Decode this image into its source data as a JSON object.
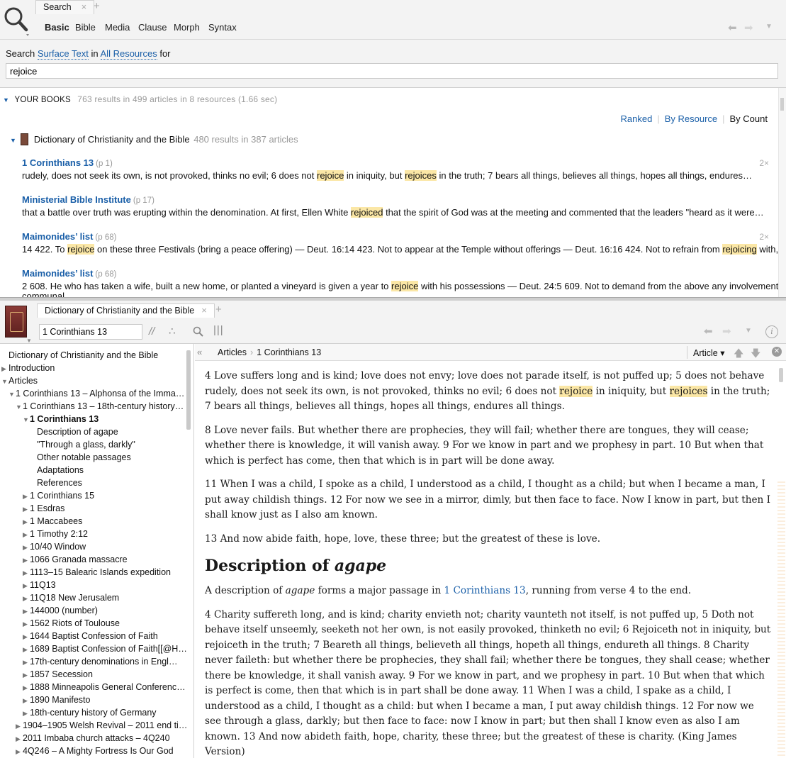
{
  "search_panel": {
    "tab_label": "Search",
    "tab_close": "×",
    "tab_add": "+",
    "subtabs": [
      "Basic",
      "Bible",
      "Media",
      "Clause",
      "Morph",
      "Syntax"
    ],
    "active_subtab": "Basic",
    "search_prefix": "Search",
    "search_field": "Surface Text",
    "search_in": "in",
    "search_scope": "All Resources",
    "search_for": "for",
    "query": "rejoice"
  },
  "results": {
    "section_title": "YOUR BOOKS",
    "summary": "763 results in 499 articles in 8 resources (1.66 sec)",
    "ranking": [
      "Ranked",
      "By Resource",
      "By Count"
    ],
    "active_ranking": "By Count",
    "book": {
      "title": "Dictionary of Christianity and the Bible",
      "count": "480 results in 387 articles"
    },
    "items": [
      {
        "title": "1 Corinthians 13",
        "page": "(p 1)",
        "count": "2×",
        "snippet": [
          {
            "t": "rudely, does not seek its own, is not provoked, thinks no evil; 6 does not "
          },
          {
            "t": "rejoice",
            "h": true
          },
          {
            "t": " in iniquity, but "
          },
          {
            "t": "rejoices",
            "h": true
          },
          {
            "t": " in the truth; 7 bears all things, believes all things, hopes all things, endures…"
          }
        ]
      },
      {
        "title": "Ministerial Bible Institute",
        "page": "(p 17)",
        "count": "",
        "snippet": [
          {
            "t": "that a battle over truth was erupting within the denomination. At first, Ellen White "
          },
          {
            "t": "rejoiced",
            "h": true
          },
          {
            "t": " that the spirit of God was at the meeting and commented that the leaders \"heard as it were…"
          }
        ]
      },
      {
        "title": "Maimonides’ list",
        "page": "(p 68)",
        "count": "2×",
        "snippet": [
          {
            "t": "14 422. To "
          },
          {
            "t": "rejoice",
            "h": true
          },
          {
            "t": " on these three Festivals (bring a peace offering) — Deut. 16:14 423. Not to appear at the Temple without offerings — Deut. 16:16 424. Not to refrain from "
          },
          {
            "t": "rejoicing",
            "h": true
          },
          {
            "t": " with, and…"
          }
        ]
      },
      {
        "title": "Maimonides’ list",
        "page": "(p 68)",
        "count": "",
        "snippet": [
          {
            "t": "2 608. He who has taken a wife, built a new home, or planted a vineyard is given a year to "
          },
          {
            "t": "rejoice",
            "h": true
          },
          {
            "t": " with his possessions — Deut. 24:5 609. Not to demand from the above any involvement,"
          }
        ],
        "snippet2": "communal"
      }
    ]
  },
  "resource_panel": {
    "tab_label": "Dictionary of Christianity and the Bible",
    "tab_close": "×",
    "tab_add": "+",
    "reference": "1 Corinthians 13",
    "breadcrumb": [
      "Articles",
      "1 Corinthians 13"
    ],
    "article_menu": "Article ▾",
    "toc": [
      {
        "label": "Dictionary of Christianity and the Bible",
        "level": 0,
        "arrow": "",
        "bold": false
      },
      {
        "label": "Introduction",
        "level": 0,
        "arrow": "▶",
        "bold": false
      },
      {
        "label": "Articles",
        "level": 0,
        "arrow": "▼",
        "bold": false
      },
      {
        "label": "1 Corinthians 13 – Alphonsa of the Imma…",
        "level": 1,
        "arrow": "▼",
        "bold": false
      },
      {
        "label": "1 Corinthians 13 – 18th-century history…",
        "level": 2,
        "arrow": "▼",
        "bold": false
      },
      {
        "label": "1 Corinthians 13",
        "level": 3,
        "arrow": "▼",
        "bold": true
      },
      {
        "label": "Description of agape",
        "level": 4,
        "arrow": "",
        "bold": false
      },
      {
        "label": "\"Through a glass, darkly\"",
        "level": 4,
        "arrow": "",
        "bold": false
      },
      {
        "label": "Other notable passages",
        "level": 4,
        "arrow": "",
        "bold": false
      },
      {
        "label": "Adaptations",
        "level": 4,
        "arrow": "",
        "bold": false
      },
      {
        "label": "References",
        "level": 4,
        "arrow": "",
        "bold": false
      },
      {
        "label": "1 Corinthians 15",
        "level": 3,
        "arrow": "▶",
        "bold": false
      },
      {
        "label": "1 Esdras",
        "level": 3,
        "arrow": "▶",
        "bold": false
      },
      {
        "label": "1 Maccabees",
        "level": 3,
        "arrow": "▶",
        "bold": false
      },
      {
        "label": "1 Timothy 2:12",
        "level": 3,
        "arrow": "▶",
        "bold": false
      },
      {
        "label": "10/40 Window",
        "level": 3,
        "arrow": "▶",
        "bold": false
      },
      {
        "label": "1066 Granada massacre",
        "level": 3,
        "arrow": "▶",
        "bold": false
      },
      {
        "label": "1113–15 Balearic Islands expedition",
        "level": 3,
        "arrow": "▶",
        "bold": false
      },
      {
        "label": "11Q13",
        "level": 3,
        "arrow": "▶",
        "bold": false
      },
      {
        "label": "11Q18 New Jerusalem",
        "level": 3,
        "arrow": "▶",
        "bold": false
      },
      {
        "label": "144000 (number)",
        "level": 3,
        "arrow": "▶",
        "bold": false
      },
      {
        "label": "1562 Riots of Toulouse",
        "level": 3,
        "arrow": "▶",
        "bold": false
      },
      {
        "label": "1644 Baptist Confession of Faith",
        "level": 3,
        "arrow": "▶",
        "bold": false
      },
      {
        "label": "1689 Baptist Confession of Faith[[@H…",
        "level": 3,
        "arrow": "▶",
        "bold": false
      },
      {
        "label": "17th-century denominations in Engl…",
        "level": 3,
        "arrow": "▶",
        "bold": false
      },
      {
        "label": "1857 Secession",
        "level": 3,
        "arrow": "▶",
        "bold": false
      },
      {
        "label": "1888 Minneapolis General Conferenc…",
        "level": 3,
        "arrow": "▶",
        "bold": false
      },
      {
        "label": "1890 Manifesto",
        "level": 3,
        "arrow": "▶",
        "bold": false
      },
      {
        "label": "18th-century history of Germany",
        "level": 3,
        "arrow": "▶",
        "bold": false
      },
      {
        "label": "1904–1905 Welsh Revival – 2011 end ti…",
        "level": 2,
        "arrow": "▶",
        "bold": false
      },
      {
        "label": "2011 Imbaba church attacks – 4Q240",
        "level": 2,
        "arrow": "▶",
        "bold": false
      },
      {
        "label": "4Q246 – A Mighty Fortress Is Our God",
        "level": 2,
        "arrow": "▶",
        "bold": false
      }
    ],
    "article": {
      "p1": [
        {
          "t": "4 Love suffers long and is kind; love does not envy; love does not parade itself, is not puffed up; 5 does not behave rudely, does not seek its own, is not provoked, thinks no evil; 6 does not "
        },
        {
          "t": "rejoice",
          "h": true
        },
        {
          "t": " in iniquity, but "
        },
        {
          "t": "rejoices",
          "h": true
        },
        {
          "t": " in the truth; 7 bears all things, believes all things, hopes all things, endures all things."
        }
      ],
      "p2": "8 Love never fails. But whether there are prophecies, they will fail; whether there are tongues, they will cease; whether there is knowledge, it will vanish away. 9 For we know in part and we prophesy in part. 10 But when that which is perfect has come, then that which is in part will be done away.",
      "p3": "11 When I was a child, I spoke as a child, I understood as a child, I thought as a child; but when I became a man, I put away childish things. 12 For now we see in a mirror, dimly, but then face to face. Now I know in part, but then I shall know just as I also am known.",
      "p4": "13 And now abide faith, hope, love, these three; but the greatest of these is love.",
      "heading_plain": "Description of ",
      "heading_italic": "agape",
      "p5_a": "A description of ",
      "p5_i": "agape",
      "p5_b": " forms a major passage in ",
      "p5_link": "1 Corinthians 13",
      "p5_c": ", running from verse 4 to the end.",
      "p6": "4 Charity suffereth long, and is kind; charity envieth not; charity vaunteth not itself, is not puffed up, 5 Doth not behave itself unseemly, seeketh not her own, is not easily provoked, thinketh no evil; 6 Rejoiceth not in iniquity, but rejoiceth in the truth; 7 Beareth all things, believeth all things, hopeth all things, endureth all things. 8 Charity never faileth: but whether there be prophecies, they shall fail; whether there be tongues, they shall cease; whether there be knowledge, it shall vanish away. 9 For we know in part, and we prophesy in part. 10 But when that which is perfect is come, then that which is in part shall be done away. 11 When I was a child, I spake as a child, I understood as a child, I thought as a child: but when I became a man, I put away childish things. 12 For now we see through a glass, darkly; but then face to face: now I know in part; but then shall I know even as also I am known. 13 And now abideth faith, hope, charity, these three; but the greatest of these is charity. (King James Version)"
    }
  },
  "colors": {
    "link": "#1a5fa8",
    "highlight": "#fbe7a6"
  }
}
